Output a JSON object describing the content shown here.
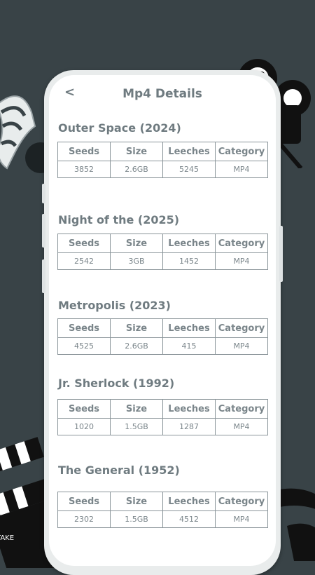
{
  "header": {
    "title": "Mp4 Details",
    "back_icon": "<"
  },
  "columns": [
    "Seeds",
    "Size",
    "Leeches",
    "Category"
  ],
  "movies": [
    {
      "title": "Outer Space (2024)",
      "seeds": "3852",
      "size": "2.6GB",
      "leeches": "5245",
      "category": "MP4"
    },
    {
      "title": "Night of the (2025)",
      "seeds": "2542",
      "size": "3GB",
      "leeches": "1452",
      "category": "MP4"
    },
    {
      "title": "Metropolis (2023)",
      "seeds": "4525",
      "size": "2.6GB",
      "leeches": "415",
      "category": "MP4"
    },
    {
      "title": "Jr. Sherlock (1992)",
      "seeds": "1020",
      "size": "1.5GB",
      "leeches": "1287",
      "category": "MP4"
    },
    {
      "title": "The General (1952)",
      "seeds": "2302",
      "size": "1.5GB",
      "leeches": "4512",
      "category": "MP4"
    }
  ],
  "clapper_text": "TAKE",
  "colors": {
    "background": "#394347",
    "text": "#6f7b80",
    "table_border": "#8b959a",
    "screen": "#ffffff"
  }
}
